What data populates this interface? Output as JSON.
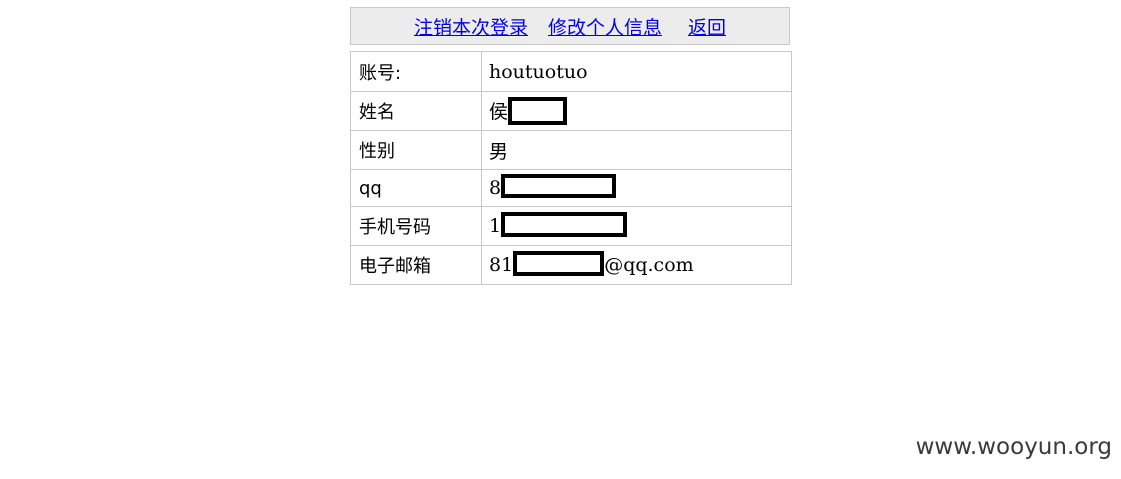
{
  "nav": {
    "logout": "注销本次登录",
    "edit_profile": "修改个人信息",
    "back": "返回"
  },
  "profile": {
    "rows": [
      {
        "label": "账号:",
        "value": "houtuotuo"
      },
      {
        "label": "姓名",
        "value_prefix": "侯",
        "value_suffix": ""
      },
      {
        "label": "性别",
        "value": "男"
      },
      {
        "label": "qq",
        "value_prefix": "8",
        "value_suffix": ""
      },
      {
        "label": "手机号码",
        "value_prefix": "1",
        "value_suffix": ""
      },
      {
        "label": "电子邮箱",
        "value_prefix": "81",
        "value_suffix": "@qq.com"
      }
    ]
  },
  "watermark": "www.wooyun.org"
}
